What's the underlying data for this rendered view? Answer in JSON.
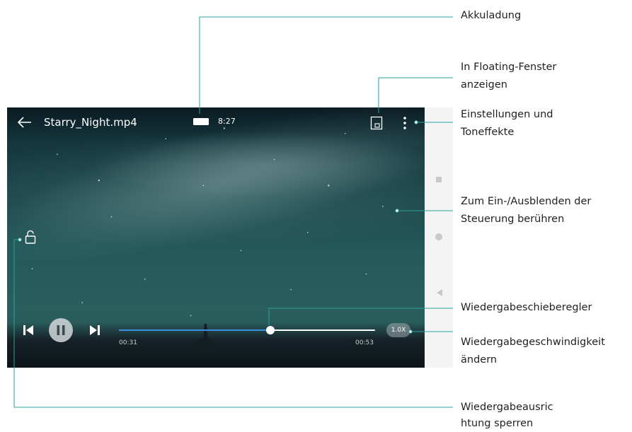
{
  "video": {
    "title": "Starry_Night.mp4",
    "clock": "8:27",
    "current_time": "00:31",
    "total_time": "00:53",
    "progress": 0.59,
    "speed": "1.0X"
  },
  "icons": {
    "back": "arrow-left-icon",
    "battery": "battery-icon",
    "floating_window": "floating-window-icon",
    "more": "vertical-dots-icon",
    "lock": "unlocked-padlock-icon",
    "previous": "skip-previous-icon",
    "pause": "pause-icon",
    "next": "skip-next-icon",
    "nav_recent": "square-icon",
    "nav_home": "circle-icon",
    "nav_back": "triangle-back-icon"
  },
  "colors": {
    "progress_fill": "#3b8ee3",
    "callout_line": "#2aa198",
    "label_text": "#222222"
  },
  "callouts": {
    "battery": "Akkuladung",
    "floating_window_1": "In Floating-Fenster",
    "floating_window_2": "anzeigen",
    "settings_1": "Einstellungen und",
    "settings_2": "Toneffekte",
    "toggle_controls_1": "Zum Ein-/Ausblenden der",
    "toggle_controls_2": "Steuerung berühren",
    "seek_slider": "Wiedergabeschieberegler",
    "speed_1": "Wiedergabegeschwindigkeit",
    "speed_2": "ändern",
    "lock_1": "Wiedergabeausric",
    "lock_2": "htung sperren"
  }
}
